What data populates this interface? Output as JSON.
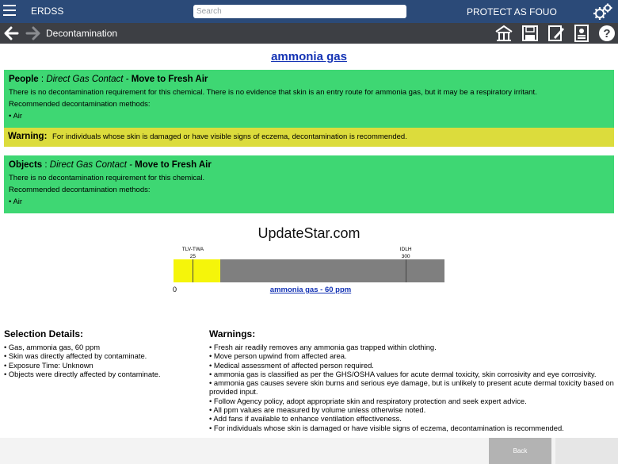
{
  "topbar": {
    "app_title": "ERDSS",
    "search_placeholder": "Search",
    "classification": "PROTECT AS FOUO"
  },
  "navbar": {
    "title": "Decontamination",
    "icons": [
      "home-icon",
      "save-icon",
      "edit-icon",
      "report-icon",
      "help-icon"
    ]
  },
  "chemical": "ammonia gas",
  "people": {
    "category": "People",
    "route": "Direct  Gas  Contact -",
    "action": "Move to Fresh Air",
    "lines": [
      "There is no decontamination requirement for this chemical. There is no evidence that skin is an entry route for ammonia gas, but it may be a respiratory irritant.",
      "Recommended decontamination methods:",
      "• Air"
    ]
  },
  "warning": {
    "label": "Warning:",
    "text": "For individuals whose skin is damaged or have visible signs of eczema, decontamination is recommended."
  },
  "objects": {
    "category": "Objects",
    "route": "Direct  Gas  Contact -",
    "action": "Move to Fresh Air",
    "lines": [
      "There is no decontamination requirement for this chemical.",
      "Recommended decontamination methods:",
      "• Air"
    ]
  },
  "watermark": "UpdateStar.com",
  "gauge": {
    "max_ppm": 350,
    "exposure_ppm": 60,
    "tlv_label": "TLV-TWA",
    "tlv_value": 25,
    "idlh_label": "IDLH",
    "idlh_value": 300,
    "zero_label": "0",
    "caption": "ammonia gas - 60 ppm",
    "colors": {
      "fill": "#f5f50a",
      "track": "#7f7f7f"
    }
  },
  "selection": {
    "title": "Selection Details:",
    "items": [
      "• Gas, ammonia gas, 60 ppm",
      "• Skin was directly affected by contaminate.",
      "• Exposure Time: Unknown",
      "• Objects were directly affected by contaminate."
    ]
  },
  "warnings": {
    "title": "Warnings:",
    "items": [
      "• Fresh air readily removes any ammonia gas trapped within clothing.",
      "• Move person upwind from affected area.",
      "• Medical assessment of affected person required.",
      "• ammonia gas is classified as per the GHS/OSHA values for acute dermal toxicity, skin corrosivity and eye corrosivity.",
      "• ammonia gas causes severe skin burns and serious eye damage, but is unlikely to present acute dermal toxicity based on provided input.",
      "• Follow Agency policy, adopt appropriate skin and respiratory protection and seek expert advice.",
      "• All ppm values are measured by volume unless otherwise noted.",
      "• Add fans if available to enhance ventilation effectiveness.",
      "• For individuals whose skin is damaged or have visible signs of eczema, decontamination is recommended."
    ]
  },
  "footer": {
    "back_label": "Back"
  },
  "colors": {
    "topbar": "#2b4a78",
    "navbar": "#3d3f44",
    "green_panel": "#3ed773",
    "warning_panel": "#dcdc3c",
    "link": "#1433b4"
  }
}
